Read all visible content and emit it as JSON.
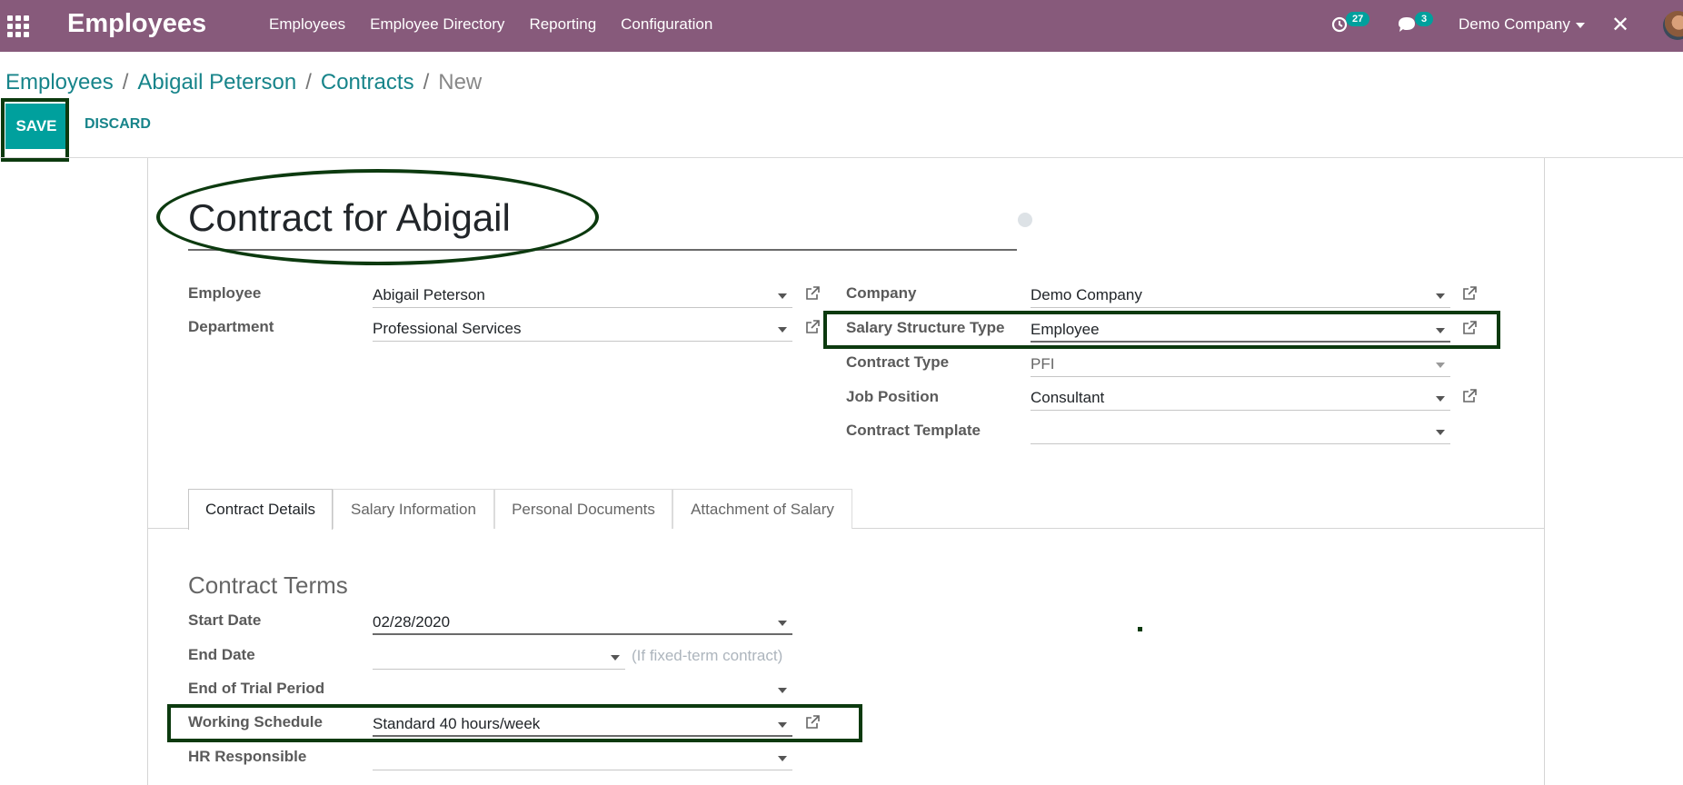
{
  "navbar": {
    "app_title": "Employees",
    "menu": [
      "Employees",
      "Employee Directory",
      "Reporting",
      "Configuration"
    ],
    "activity_count": "27",
    "message_count": "3",
    "company": "Demo Company"
  },
  "breadcrumb": {
    "items": [
      "Employees",
      "Abigail Peterson",
      "Contracts"
    ],
    "current": "New",
    "separator": "/"
  },
  "buttons": {
    "save": "SAVE",
    "discard": "DISCARD"
  },
  "form": {
    "title": "Contract for Abigail",
    "left": {
      "employee": {
        "label": "Employee",
        "value": "Abigail Peterson"
      },
      "department": {
        "label": "Department",
        "value": "Professional Services"
      }
    },
    "right": {
      "company": {
        "label": "Company",
        "value": "Demo Company"
      },
      "salary_structure_type": {
        "label": "Salary Structure Type",
        "value": "Employee"
      },
      "contract_type": {
        "label": "Contract Type",
        "value": "PFI"
      },
      "job_position": {
        "label": "Job Position",
        "value": "Consultant"
      },
      "contract_template": {
        "label": "Contract Template",
        "value": ""
      }
    }
  },
  "tabs": [
    "Contract Details",
    "Salary Information",
    "Personal Documents",
    "Attachment of Salary"
  ],
  "contract_terms": {
    "title": "Contract Terms",
    "start_date": {
      "label": "Start Date",
      "value": "02/28/2020"
    },
    "end_date": {
      "label": "End Date",
      "value": "",
      "hint": "(If fixed-term contract)"
    },
    "trial_end": {
      "label": "End of Trial Period",
      "value": ""
    },
    "working_schedule": {
      "label": "Working Schedule",
      "value": "Standard 40 hours/week"
    },
    "hr_responsible": {
      "label": "HR Responsible",
      "value": ""
    }
  },
  "colors": {
    "navbar": "#875a7b",
    "primary": "#00a09d",
    "link": "#17848a",
    "highlight": "#0c3a0f"
  }
}
